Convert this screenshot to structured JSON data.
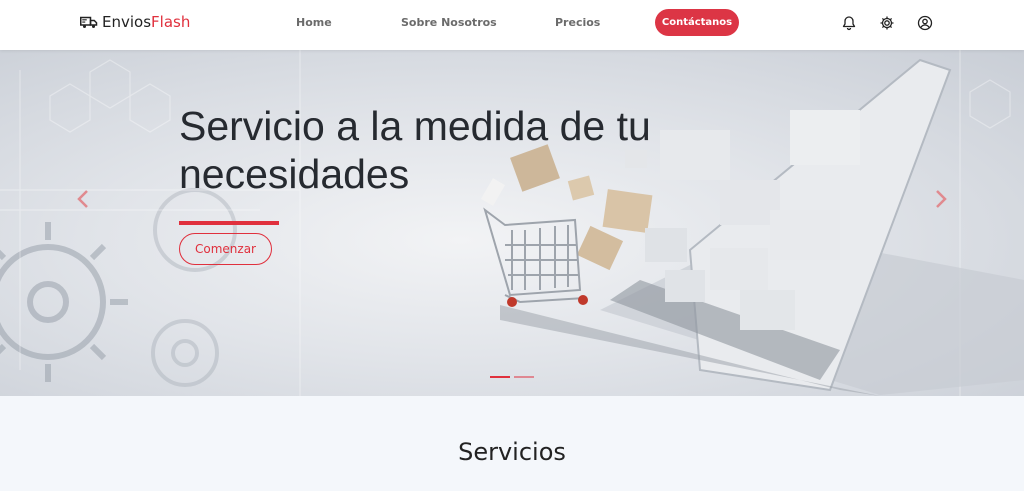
{
  "brand": {
    "name_part1": "Envios",
    "name_part2": "Flash",
    "accent_color": "#e0303d"
  },
  "nav": {
    "items": [
      {
        "label": "Home"
      },
      {
        "label": "Sobre Nosotros"
      },
      {
        "label": "Precios"
      }
    ],
    "contact_label": "Contáctanos",
    "icons": [
      "bell-icon",
      "gear-icon",
      "user-circle-icon"
    ]
  },
  "hero": {
    "title": "Servicio a la medida de tu necesidades",
    "button_label": "Comenzar",
    "slides_count": 2,
    "active_slide": 1
  },
  "services": {
    "title": "Servicios"
  }
}
